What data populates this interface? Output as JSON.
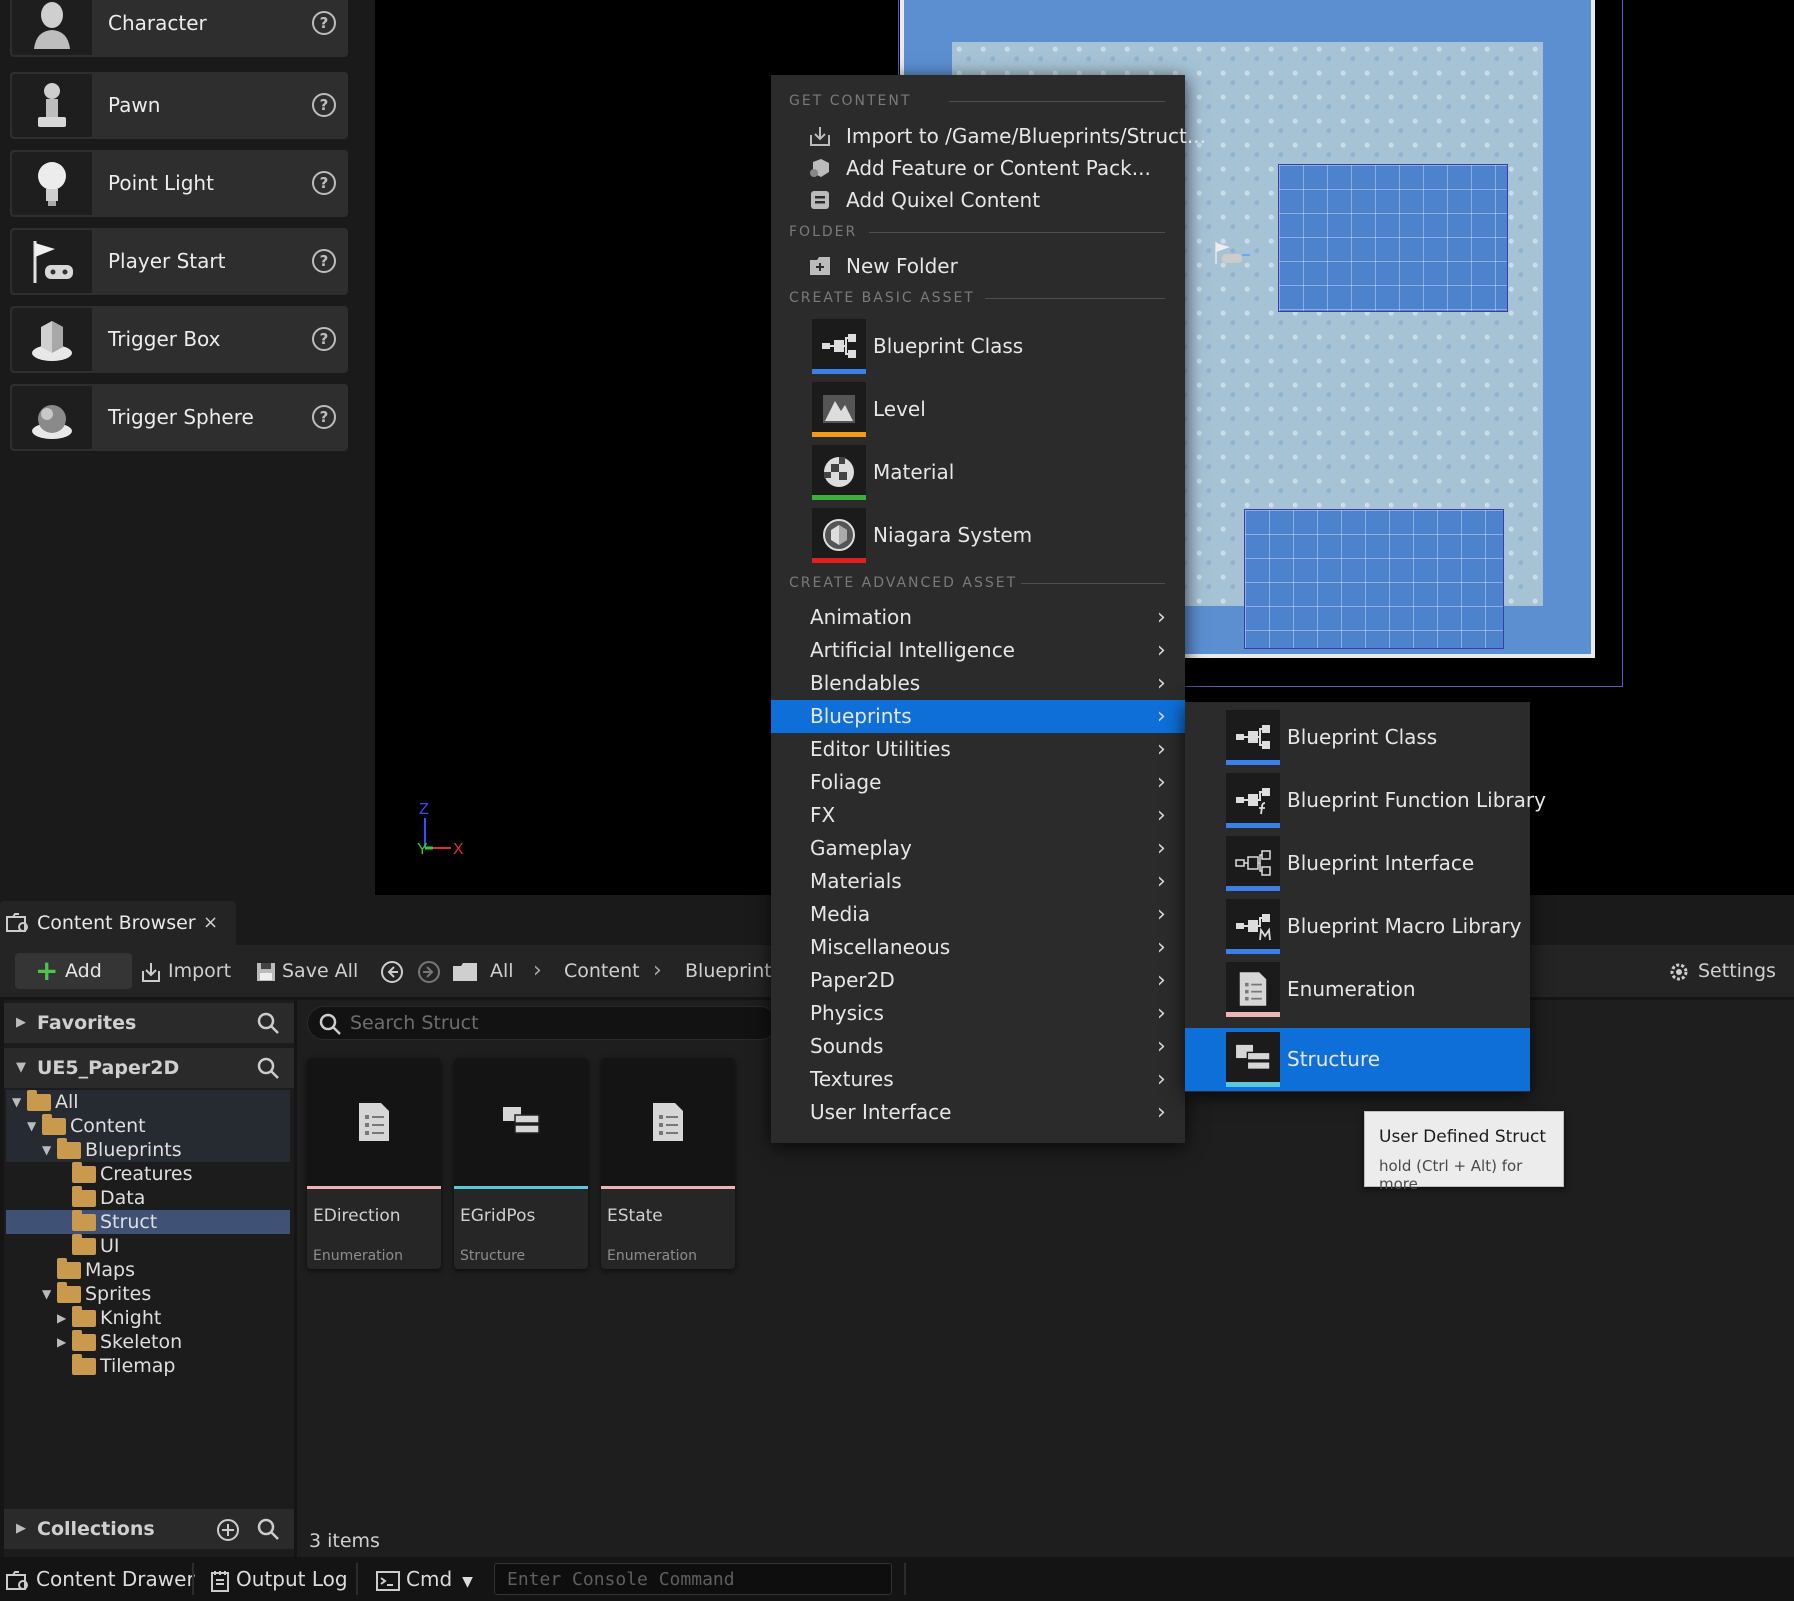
{
  "place_panel": {
    "items": [
      {
        "label": "Character",
        "icon": "character-icon"
      },
      {
        "label": "Pawn",
        "icon": "pawn-icon"
      },
      {
        "label": "Point Light",
        "icon": "light-bulb-icon"
      },
      {
        "label": "Player Start",
        "icon": "player-start-icon"
      },
      {
        "label": "Trigger Box",
        "icon": "trigger-box-icon"
      },
      {
        "label": "Trigger Sphere",
        "icon": "trigger-sphere-icon"
      }
    ]
  },
  "viewport": {
    "axis": {
      "z": "Z",
      "y": "Y",
      "x": "X"
    },
    "colors": {
      "x": "#e23030",
      "y": "#30d030",
      "z": "#3a4dff"
    }
  },
  "context_menu": {
    "sections": {
      "get_content": "GET CONTENT",
      "folder": "FOLDER",
      "create_basic": "CREATE BASIC ASSET",
      "create_advanced": "CREATE ADVANCED ASSET"
    },
    "get_content_items": [
      {
        "label": "Import to /Game/Blueprints/Struct...",
        "icon": "import-icon"
      },
      {
        "label": "Add Feature or Content Pack...",
        "icon": "feature-pack-icon"
      },
      {
        "label": "Add Quixel Content",
        "icon": "quixel-icon"
      }
    ],
    "folder_items": [
      {
        "label": "New Folder",
        "icon": "new-folder-icon"
      }
    ],
    "basic_assets": [
      {
        "label": "Blueprint Class",
        "icon": "blueprint-class-icon",
        "color": "#3b7fe8"
      },
      {
        "label": "Level",
        "icon": "level-icon",
        "color": "#f29a1a"
      },
      {
        "label": "Material",
        "icon": "material-icon",
        "color": "#3fae3f"
      },
      {
        "label": "Niagara System",
        "icon": "niagara-system-icon",
        "color": "#e02020"
      }
    ],
    "advanced_categories": [
      "Animation",
      "Artificial Intelligence",
      "Blendables",
      "Blueprints",
      "Editor Utilities",
      "Foliage",
      "FX",
      "Gameplay",
      "Materials",
      "Media",
      "Miscellaneous",
      "Paper2D",
      "Physics",
      "Sounds",
      "Textures",
      "User Interface"
    ],
    "highlighted_category": "Blueprints",
    "highlight_color": "#0e6fd9"
  },
  "submenu": {
    "items": [
      {
        "label": "Blueprint Class",
        "icon": "blueprint-class-icon",
        "color": "#3b7fe8"
      },
      {
        "label": "Blueprint Function Library",
        "icon": "blueprint-function-library-icon",
        "color": "#3b7fe8"
      },
      {
        "label": "Blueprint Interface",
        "icon": "blueprint-interface-icon",
        "color": "#3b7fe8"
      },
      {
        "label": "Blueprint Macro Library",
        "icon": "blueprint-macro-library-icon",
        "color": "#3b7fe8"
      },
      {
        "label": "Enumeration",
        "icon": "enumeration-icon",
        "color": "#f0b3b3"
      },
      {
        "label": "Structure",
        "icon": "structure-icon",
        "color": "#5ac8d8"
      }
    ],
    "highlighted_item": "Structure"
  },
  "tooltip": {
    "title": "User Defined Struct",
    "hint": "hold (Ctrl + Alt) for more"
  },
  "content_browser": {
    "tab_label": "Content Browser",
    "tab_close": "×",
    "toolbar": {
      "add": "Add",
      "import": "Import",
      "save_all": "Save All",
      "breadcrumb": [
        "All",
        "Content",
        "Blueprints"
      ],
      "settings": "Settings"
    },
    "sources": {
      "favorites": "Favorites",
      "project": "UE5_Paper2D",
      "collections": "Collections"
    },
    "tree": [
      {
        "label": "All",
        "depth": 0,
        "expanded": true,
        "state": "pale"
      },
      {
        "label": "Content",
        "depth": 1,
        "expanded": true,
        "state": "pale"
      },
      {
        "label": "Blueprints",
        "depth": 2,
        "expanded": true,
        "state": "pale"
      },
      {
        "label": "Creatures",
        "depth": 3,
        "expanded": null,
        "state": ""
      },
      {
        "label": "Data",
        "depth": 3,
        "expanded": null,
        "state": ""
      },
      {
        "label": "Struct",
        "depth": 3,
        "expanded": null,
        "state": "sel"
      },
      {
        "label": "UI",
        "depth": 3,
        "expanded": null,
        "state": ""
      },
      {
        "label": "Maps",
        "depth": 2,
        "expanded": null,
        "state": ""
      },
      {
        "label": "Sprites",
        "depth": 2,
        "expanded": true,
        "state": ""
      },
      {
        "label": "Knight",
        "depth": 3,
        "expanded": false,
        "state": ""
      },
      {
        "label": "Skeleton",
        "depth": 3,
        "expanded": false,
        "state": ""
      },
      {
        "label": "Tilemap",
        "depth": 3,
        "expanded": null,
        "state": ""
      }
    ],
    "search_placeholder": "Search Struct",
    "assets": [
      {
        "name": "EDirection",
        "type": "Enumeration",
        "icon": "enumeration-icon",
        "color": "#f0b3b3"
      },
      {
        "name": "EGridPos",
        "type": "Structure",
        "icon": "structure-icon",
        "color": "#5ac8d8"
      },
      {
        "name": "EState",
        "type": "Enumeration",
        "icon": "enumeration-icon",
        "color": "#f0b3b3"
      }
    ],
    "item_count": "3 items"
  },
  "status_bar": {
    "content_drawer": "Content Drawer",
    "output_log": "Output Log",
    "cmd": "Cmd",
    "console_placeholder": "Enter Console Command"
  }
}
